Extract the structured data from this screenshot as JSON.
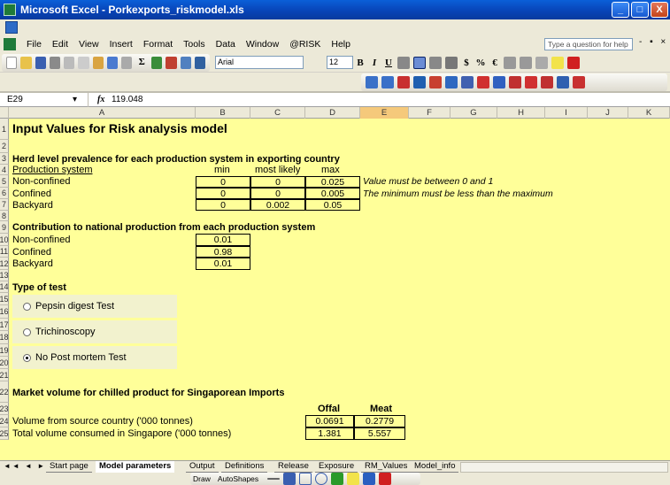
{
  "window": {
    "title": "Microsoft Excel - Porkexports_riskmodel.xls",
    "controls": [
      "_",
      "□",
      "X"
    ]
  },
  "menu": {
    "items": [
      "File",
      "Edit",
      "View",
      "Insert",
      "Format",
      "Tools",
      "Data",
      "Window",
      "@RISK",
      "Help"
    ],
    "help_placeholder": "Type a question for help"
  },
  "toolbar": {
    "font": "Arial",
    "size": "12",
    "sum_label": "Σ"
  },
  "formula_bar": {
    "name_box": "E29",
    "fx": "fx",
    "value": "119.048"
  },
  "columns": [
    "A",
    "B",
    "C",
    "D",
    "E",
    "F",
    "G",
    "H",
    "I",
    "J",
    "K"
  ],
  "selected_column": "E",
  "rows": [
    "1",
    "2",
    "3",
    "4",
    "5",
    "6",
    "7",
    "8",
    "9",
    "10",
    "11",
    "12",
    "13",
    "14",
    "15",
    "16",
    "17",
    "18",
    "19",
    "20",
    "21",
    "22",
    "23",
    "24",
    "25"
  ],
  "sheet": {
    "title": "Input Values for Risk analysis model",
    "prevalence": {
      "heading": "Herd level prevalence for each production system in exporting country",
      "col_label": "Production system",
      "headers": [
        "min",
        "most likely",
        "max"
      ],
      "rows": [
        {
          "name": "Non-confined",
          "min": "0",
          "likely": "0",
          "max": "0.025"
        },
        {
          "name": "Confined",
          "min": "0",
          "likely": "0",
          "max": "0.005"
        },
        {
          "name": "Backyard",
          "min": "0",
          "likely": "0.002",
          "max": "0.05"
        }
      ],
      "note1": "Value must be between 0 and 1",
      "note2": "The minimum must be less than the maximum"
    },
    "contribution": {
      "heading": "Contribution to national production from each production system",
      "rows": [
        {
          "name": "Non-confined",
          "value": "0.01"
        },
        {
          "name": "Confined",
          "value": "0.98"
        },
        {
          "name": "Backyard",
          "value": "0.01"
        }
      ]
    },
    "test": {
      "heading": "Type of test",
      "options": [
        "Pepsin digest Test",
        "Trichinoscopy",
        "No Post mortem Test"
      ],
      "selected": "No Post mortem Test"
    },
    "market": {
      "heading": "Market volume for chilled product for Singaporean Imports",
      "headers": [
        "Offal",
        "Meat"
      ],
      "rows": [
        {
          "name": "Volume from source country ('000 tonnes)",
          "offal": "0.0691",
          "meat": "0.2779"
        },
        {
          "name": "Total volume consumed in Singapore ('000 tonnes)",
          "offal": "1.381",
          "meat": "5.557"
        }
      ]
    }
  },
  "tabs": [
    "Start page",
    "Model parameters",
    "Output",
    "Definitions",
    "Release",
    "Exposure",
    "RM_Values",
    "Model_info"
  ],
  "active_tab": "Model parameters",
  "drawbar": {
    "draw": "Draw",
    "autoshapes": "AutoShapes"
  },
  "colors": {
    "sheet_bg": "#ffff99",
    "title_bar": "#0a5fd8",
    "selected_col": "#f5c97b"
  }
}
